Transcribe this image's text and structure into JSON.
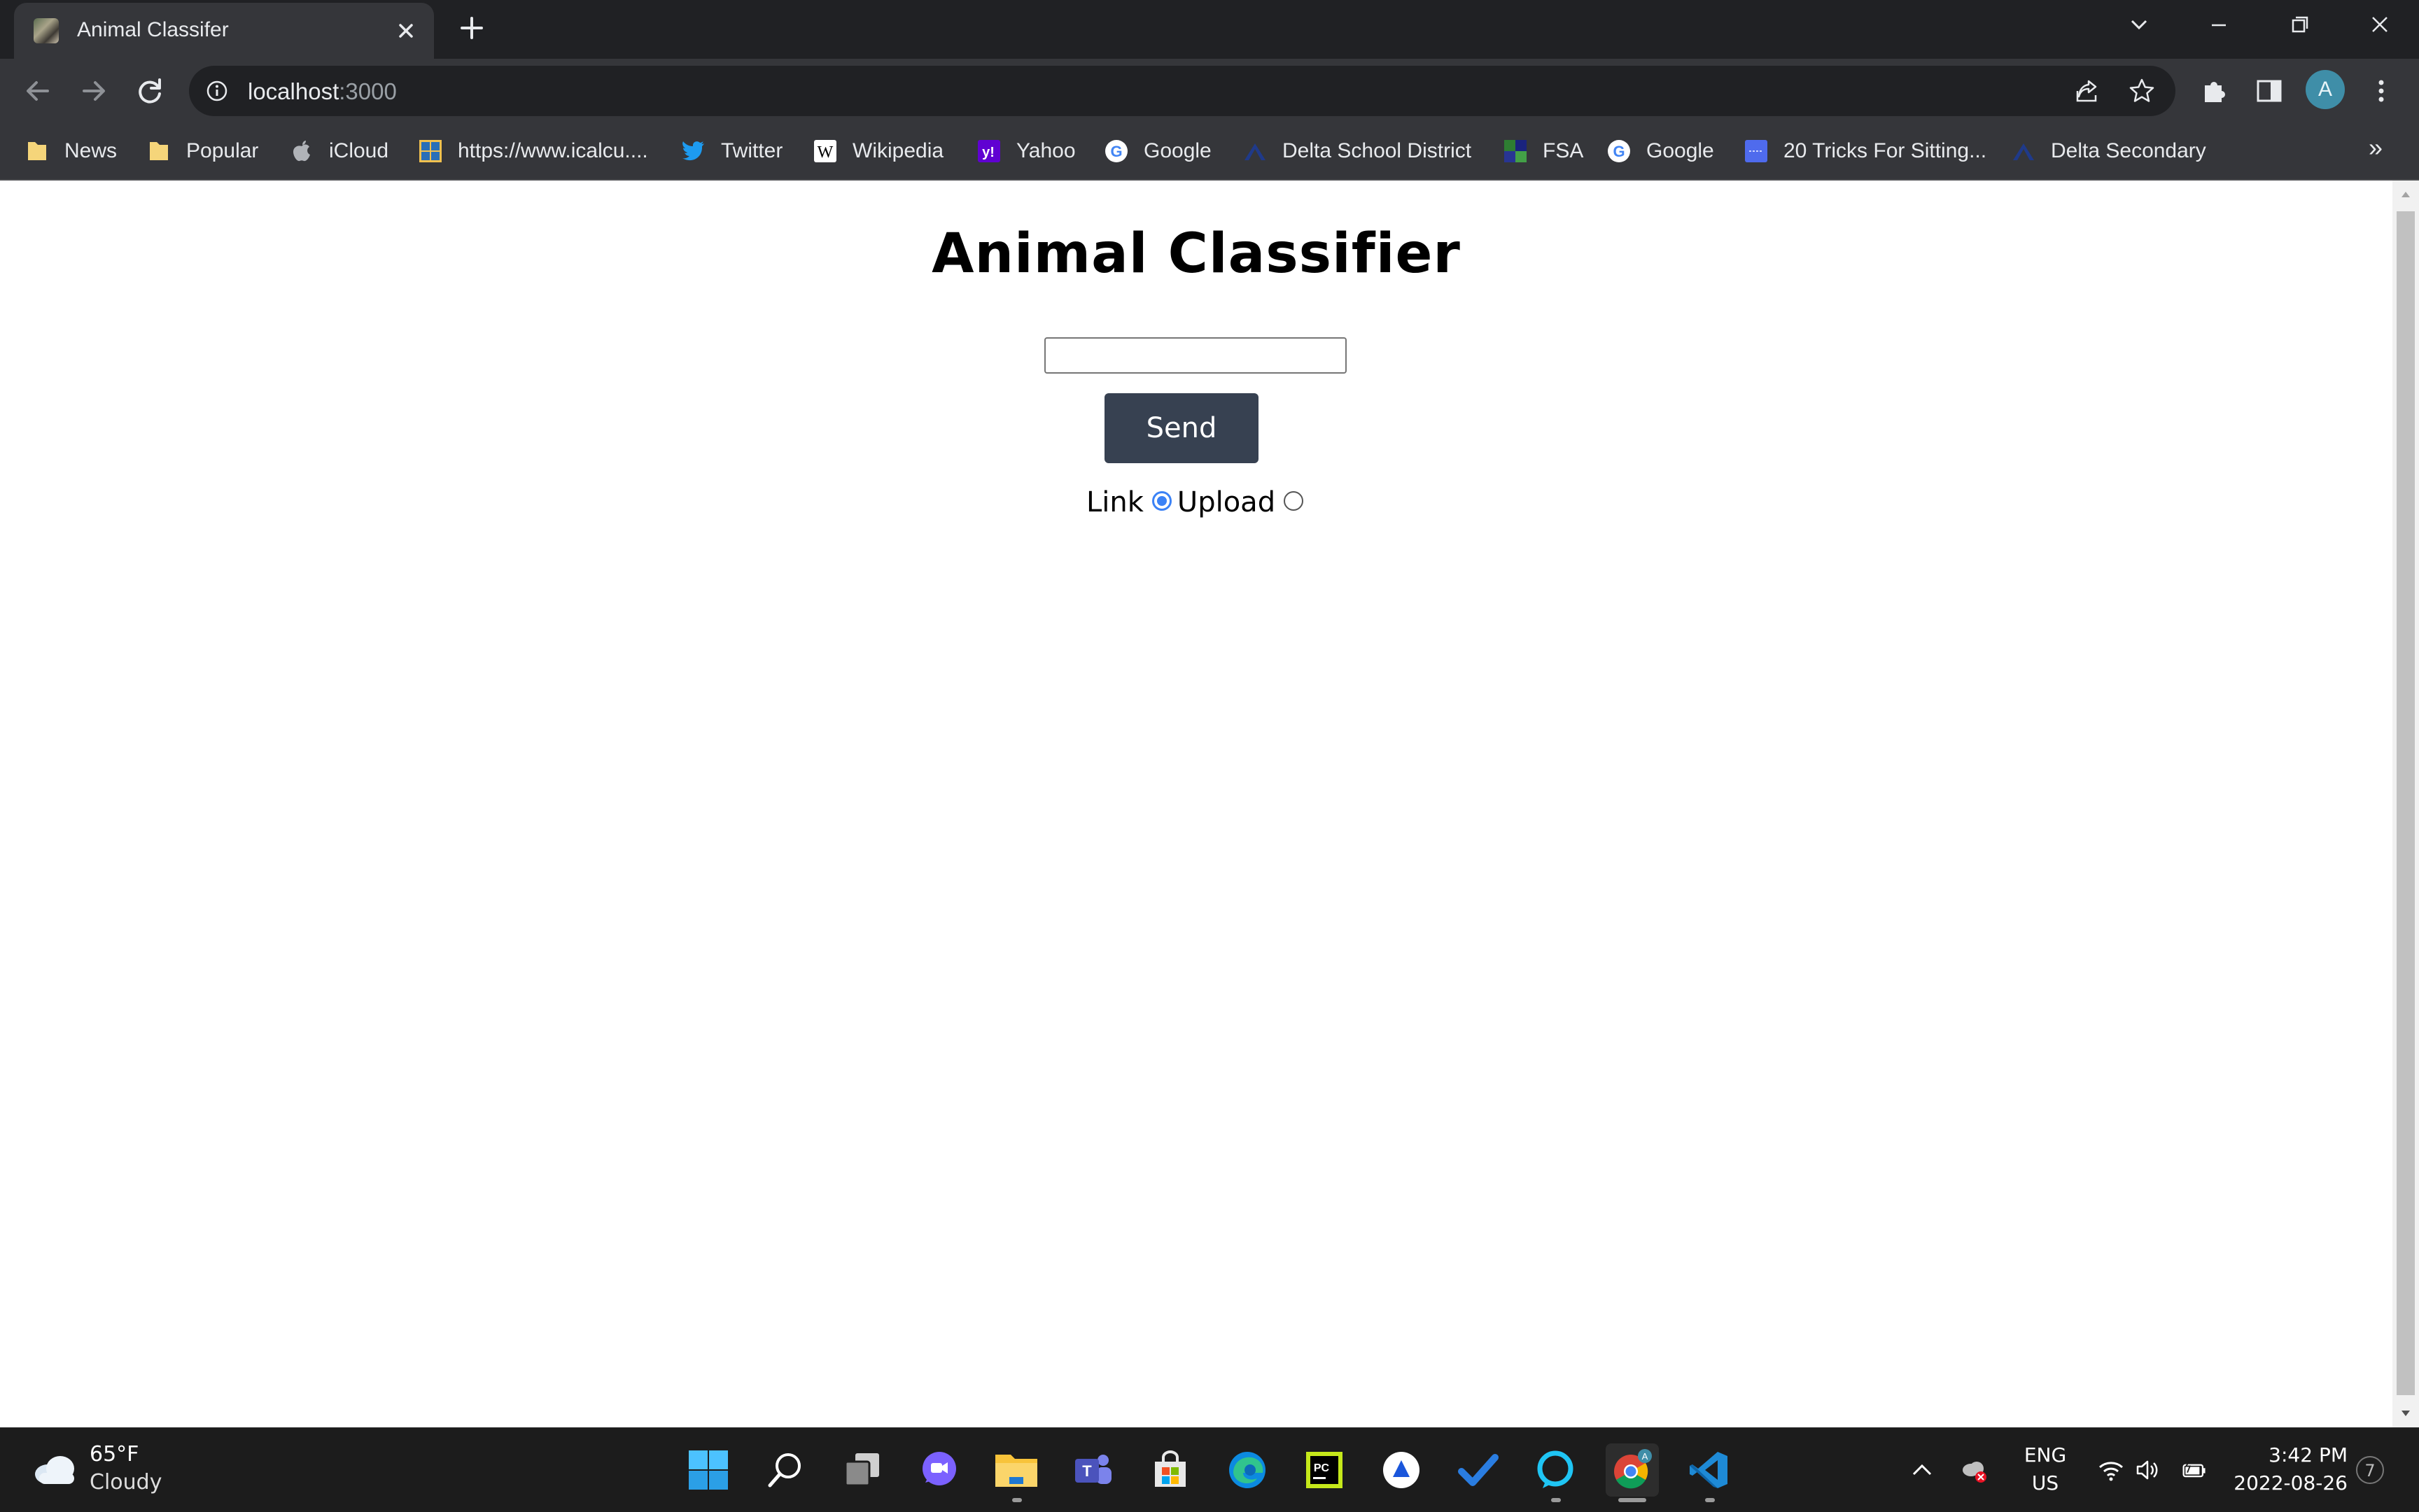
{
  "browser": {
    "tab": {
      "title": "Animal Classifer"
    },
    "address": {
      "host": "localhost",
      "port": ":3000"
    },
    "profile_initial": "A",
    "bookmarks": [
      {
        "label": "News",
        "icon": "folder-icon"
      },
      {
        "label": "Popular",
        "icon": "folder-icon"
      },
      {
        "label": "iCloud",
        "icon": "apple-icon"
      },
      {
        "label": "https://www.icalcu....",
        "icon": "calculator-icon"
      },
      {
        "label": "Twitter",
        "icon": "twitter-icon"
      },
      {
        "label": "Wikipedia",
        "icon": "wikipedia-icon"
      },
      {
        "label": "Yahoo",
        "icon": "yahoo-icon"
      },
      {
        "label": "Google",
        "icon": "google-icon"
      },
      {
        "label": "Delta School District",
        "icon": "delta-icon"
      },
      {
        "label": "FSA",
        "icon": "fsa-icon"
      },
      {
        "label": "Google",
        "icon": "google-icon"
      },
      {
        "label": "20 Tricks For Sitting...",
        "icon": "article-icon"
      },
      {
        "label": "Delta Secondary",
        "icon": "delta-icon"
      }
    ],
    "bookmarks_more": "»"
  },
  "page": {
    "title": "Animal Classifier",
    "input_value": "",
    "send_label": "Send",
    "radio_link_label": "Link",
    "radio_upload_label": "Upload",
    "selected_mode": "Link"
  },
  "taskbar": {
    "weather_temp": "65°F",
    "weather_desc": "Cloudy",
    "lang_line1": "ENG",
    "lang_line2": "US",
    "time": "3:42 PM",
    "date": "2022-08-26",
    "notification_count": "7"
  },
  "colors": {
    "tab_strip": "#202124",
    "toolbar": "#35363a",
    "send_button": "#374151",
    "radio_accent": "#3b82f6",
    "taskbar": "#1c1c1c"
  }
}
